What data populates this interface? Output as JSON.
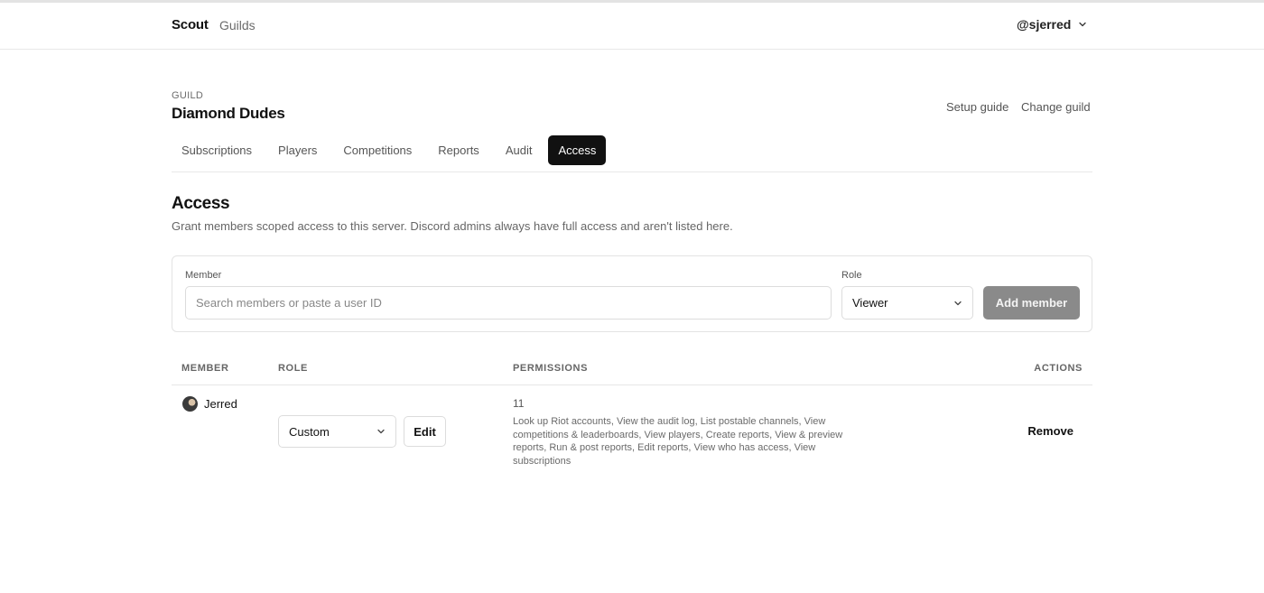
{
  "nav": {
    "brand": "Scout",
    "links": [
      "Guilds"
    ],
    "user": "@sjerred"
  },
  "guild": {
    "kicker": "GUILD",
    "name": "Diamond Dudes",
    "setup_link": "Setup guide",
    "change_link": "Change guild"
  },
  "tabs": [
    {
      "label": "Subscriptions",
      "active": false
    },
    {
      "label": "Players",
      "active": false
    },
    {
      "label": "Competitions",
      "active": false
    },
    {
      "label": "Reports",
      "active": false
    },
    {
      "label": "Audit",
      "active": false
    },
    {
      "label": "Access",
      "active": true
    }
  ],
  "access": {
    "title": "Access",
    "description": "Grant members scoped access to this server. Discord admins always have full access and aren't listed here."
  },
  "form": {
    "member_label": "Member",
    "member_placeholder": "Search members or paste a user ID",
    "member_value": "",
    "role_label": "Role",
    "role_value": "Viewer",
    "add_button": "Add member"
  },
  "table": {
    "headers": {
      "member": "MEMBER",
      "role": "ROLE",
      "permissions": "PERMISSIONS",
      "actions": "ACTIONS"
    },
    "rows": [
      {
        "member": "Jerred",
        "role": "Custom",
        "edit": "Edit",
        "permission_count": "11",
        "permissions": "Look up Riot accounts, View the audit log, List postable channels, View competitions & leaderboards, View players, Create reports, View & preview reports, Run & post reports, Edit reports, View who has access, View subscriptions",
        "action": "Remove"
      }
    ]
  },
  "icons": {
    "chevron": "chevron-down-icon",
    "avatar": "avatar"
  },
  "colors": {
    "active_tab": "#111111",
    "add_button_disabled": "#8a8a8a"
  }
}
